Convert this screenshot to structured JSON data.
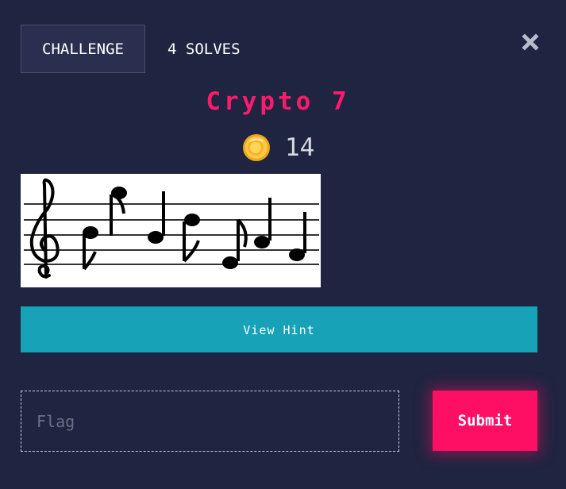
{
  "tabs": {
    "challenge_label": "CHALLENGE",
    "solves_label": "4 SOLVES"
  },
  "challenge": {
    "title": "Crypto 7",
    "points": "14",
    "image_alt": "sheet music notes"
  },
  "hint": {
    "button_label": "View Hint"
  },
  "flag_form": {
    "input_placeholder": "Flag",
    "input_value": "",
    "submit_label": "Submit"
  },
  "icons": {
    "close": "close-icon",
    "coin": "coin-icon",
    "music": "music-notes-image"
  },
  "colors": {
    "background": "#1f2440",
    "title": "#ff1a6c",
    "hint_button": "#17a2b8",
    "submit_button": "#ff0f64"
  }
}
